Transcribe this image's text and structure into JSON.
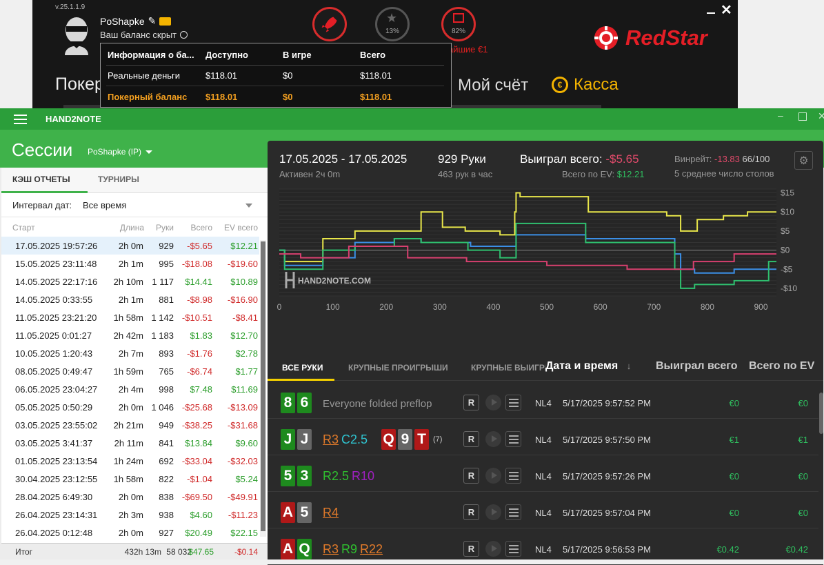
{
  "redstar": {
    "version": "v.25.1.1.9",
    "username": "PoShapke",
    "balance_hidden": "Ваш баланс скрыт",
    "rank_pct": "13%",
    "gift_pct": "82%",
    "bonus_text": "айшие €1",
    "logo_text": "RedStar",
    "nav_left": "Покер",
    "nav_account": "Мой счёт",
    "nav_cashier": "Касса",
    "balance_popup": {
      "headers": [
        "Информация о ба...",
        "Доступно",
        "В игре",
        "Всего"
      ],
      "rows": [
        [
          "Реальные деньги",
          "$118.01",
          "$0",
          "$118.01"
        ],
        [
          "Покерный баланс",
          "$118.01",
          "$0",
          "$118.01"
        ]
      ]
    }
  },
  "h2n": {
    "app_name": "HAND2NOTE",
    "title": "Сессии",
    "player": "PoShapke (IP)",
    "tabs": [
      "КЭШ ОТЧЕТЫ",
      "ТУРНИРЫ"
    ],
    "interval_label": "Интервал дат:",
    "interval_value": "Все время",
    "columns": [
      "Старт",
      "Длина",
      "Руки",
      "Всего",
      "EV всего"
    ],
    "sessions": [
      [
        "17.05.2025 19:57:26",
        "2h 0m",
        "929",
        "-$5.65",
        "$12.21"
      ],
      [
        "15.05.2025 23:11:48",
        "2h 1m",
        "995",
        "-$18.08",
        "-$19.60"
      ],
      [
        "14.05.2025 22:17:16",
        "2h 10m",
        "1 117",
        "$14.41",
        "$10.89"
      ],
      [
        "14.05.2025 0:33:55",
        "2h 1m",
        "881",
        "-$8.98",
        "-$16.90"
      ],
      [
        "11.05.2025 23:21:20",
        "1h 58m",
        "1 142",
        "-$10.51",
        "-$8.41"
      ],
      [
        "11.05.2025 0:01:27",
        "2h 42m",
        "1 183",
        "$1.83",
        "$12.70"
      ],
      [
        "10.05.2025 1:20:43",
        "2h 7m",
        "893",
        "-$1.76",
        "$2.78"
      ],
      [
        "08.05.2025 0:49:47",
        "1h 59m",
        "765",
        "-$6.74",
        "$1.77"
      ],
      [
        "06.05.2025 23:04:27",
        "2h 4m",
        "998",
        "$7.48",
        "$11.69"
      ],
      [
        "05.05.2025 0:50:29",
        "2h 0m",
        "1 046",
        "-$25.68",
        "-$13.09"
      ],
      [
        "03.05.2025 23:55:02",
        "2h 21m",
        "949",
        "-$38.25",
        "-$31.68"
      ],
      [
        "03.05.2025 3:41:37",
        "2h 11m",
        "841",
        "$13.84",
        "$9.60"
      ],
      [
        "01.05.2025 23:13:54",
        "1h 24m",
        "692",
        "-$33.04",
        "-$32.03"
      ],
      [
        "30.04.2025 23:12:55",
        "1h 58m",
        "822",
        "-$1.04",
        "$5.24"
      ],
      [
        "28.04.2025 6:49:30",
        "2h 0m",
        "838",
        "-$69.50",
        "-$49.91"
      ],
      [
        "26.04.2025 23:14:31",
        "2h 3m",
        "938",
        "$4.60",
        "-$11.23"
      ],
      [
        "26.04.2025 0:12:48",
        "2h 0m",
        "927",
        "$20.49",
        "$22.15"
      ]
    ],
    "total": {
      "label": "Итог",
      "length": "432h 13m",
      "hands": "58 032",
      "won": "$47.65",
      "ev": "-$0.14"
    },
    "summary": {
      "date_range": "17.05.2025 - 17.05.2025",
      "active": "Активен 2ч 0m",
      "hands": "929 Руки",
      "hands_per_hour": "463 рук в час",
      "won_label": "Выиграл всего:",
      "won_value": "-$5.65",
      "ev_label": "Всего по EV:",
      "ev_value": "$12.21",
      "winrate_label": "Винрейт:",
      "winrate_value": "-13.83",
      "winrate_unit": "66/100",
      "tables": "5 среднее число столов"
    },
    "hand_tabs": [
      "ВСЕ РУКИ",
      "КРУПНЫЕ ПРОИГРЫШИ",
      "КРУПНЫЕ ВЫИГРЫШИ"
    ],
    "hand_cols": [
      "Дата и время",
      "Выиграл всего",
      "Всего по EV"
    ],
    "hands": [
      {
        "cards": [
          [
            "8",
            "g"
          ],
          [
            "6",
            "g"
          ]
        ],
        "actions": [
          [
            "Everyone folded preflop",
            "#999"
          ]
        ],
        "limit": "NL4",
        "date": "5/17/2025 9:57:52 PM",
        "won": "€0",
        "ev": "€0"
      },
      {
        "cards": [
          [
            "J",
            "g"
          ],
          [
            "J",
            "gr"
          ]
        ],
        "actions": [
          [
            "R3",
            "#e07a2a"
          ],
          [
            "C2.5",
            "#2fc4d0"
          ]
        ],
        "board": [
          [
            "Q",
            "r"
          ],
          [
            "9",
            "gr"
          ],
          [
            "T",
            "r"
          ]
        ],
        "board_note": "(7)",
        "limit": "NL4",
        "date": "5/17/2025 9:57:50 PM",
        "won": "€1",
        "ev": "€1"
      },
      {
        "cards": [
          [
            "5",
            "g"
          ],
          [
            "3",
            "g"
          ]
        ],
        "actions": [
          [
            "R2.5",
            "#2fbf2f"
          ],
          [
            "R10",
            "#a020c0"
          ]
        ],
        "limit": "NL4",
        "date": "5/17/2025 9:57:26 PM",
        "won": "€0",
        "ev": "€0"
      },
      {
        "cards": [
          [
            "A",
            "r"
          ],
          [
            "5",
            "gr"
          ]
        ],
        "actions": [
          [
            "R4",
            "#e07a2a"
          ]
        ],
        "limit": "NL4",
        "date": "5/17/2025 9:57:04 PM",
        "won": "€0",
        "ev": "€0"
      },
      {
        "cards": [
          [
            "A",
            "r"
          ],
          [
            "Q",
            "g"
          ]
        ],
        "actions": [
          [
            "R3",
            "#e07a2a"
          ],
          [
            "R9",
            "#2fbf2f"
          ],
          [
            "R22",
            "#e07a2a"
          ]
        ],
        "limit": "NL4",
        "date": "5/17/2025 9:56:53 PM",
        "won": "€0.42",
        "ev": "€0.42"
      }
    ]
  },
  "chart_data": {
    "type": "line",
    "watermark": "HAND2NOTE.COM",
    "xlim": [
      0,
      929
    ],
    "ylim": [
      -12,
      16
    ],
    "x_ticks": [
      0,
      100,
      200,
      300,
      400,
      500,
      600,
      700,
      800,
      900
    ],
    "y_ticks": [
      "$15",
      "$10",
      "$5",
      "$0",
      "-$5",
      "-$10"
    ],
    "y_tick_values": [
      15,
      10,
      5,
      0,
      -5,
      -10
    ],
    "series": [
      {
        "color": "#e8e64a",
        "x": [
          0,
          20,
          80,
          83,
          200,
          230,
          300,
          310,
          385,
          440,
          440,
          445,
          455,
          700,
          748,
          752,
          810,
          850,
          900,
          929
        ],
        "y": [
          0,
          -3,
          -3,
          3,
          5,
          5,
          10,
          6,
          5,
          4,
          10,
          15,
          14,
          10,
          9,
          5,
          8,
          9,
          10,
          10
        ]
      },
      {
        "color": "#3b8fe6",
        "x": [
          0,
          20,
          80,
          83,
          200,
          230,
          300,
          315,
          400,
          440,
          445,
          700,
          730,
          748,
          752,
          800,
          900,
          929
        ],
        "y": [
          0,
          -4,
          -4,
          -2,
          2,
          3,
          2,
          2,
          1,
          1,
          4,
          3,
          3,
          -1,
          -5,
          -6,
          -5,
          -5
        ]
      },
      {
        "color": "#2fbf6f",
        "x": [
          0,
          20,
          80,
          83,
          200,
          230,
          300,
          320,
          385,
          440,
          445,
          700,
          730,
          748,
          752,
          800,
          900,
          929
        ],
        "y": [
          0,
          -5,
          -5,
          0,
          1,
          3,
          2,
          2,
          0,
          -2,
          7,
          2,
          2,
          -5,
          -10,
          -9,
          -8,
          -3
        ]
      },
      {
        "color": "#d8406f",
        "x": [
          0,
          80,
          180,
          300,
          400,
          600,
          700,
          748,
          800,
          900,
          929
        ],
        "y": [
          -1,
          -2,
          1,
          -2,
          -3,
          -4,
          -5,
          -5,
          -3,
          -1,
          -1
        ]
      }
    ]
  }
}
